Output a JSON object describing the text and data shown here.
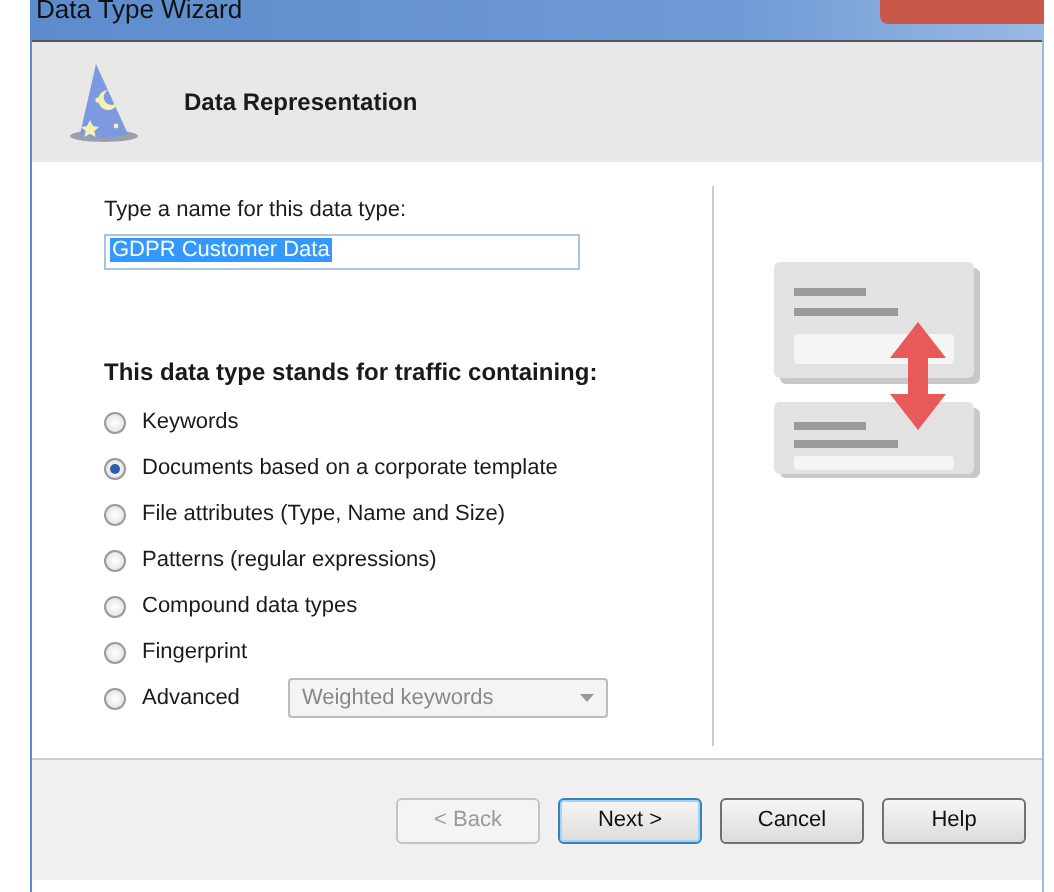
{
  "window": {
    "title": "Data Type Wizard"
  },
  "header": {
    "title": "Data Representation"
  },
  "name_field": {
    "label": "Type a name for this data type:",
    "value": "GDPR Customer Data"
  },
  "options_heading": "This data type stands for traffic containing:",
  "options": [
    {
      "label": "Keywords",
      "selected": false
    },
    {
      "label": "Documents based on a corporate template",
      "selected": true
    },
    {
      "label": "File attributes (Type, Name and Size)",
      "selected": false
    },
    {
      "label": "Patterns (regular expressions)",
      "selected": false
    },
    {
      "label": "Compound data types",
      "selected": false
    },
    {
      "label": "Fingerprint",
      "selected": false
    },
    {
      "label": "Advanced",
      "selected": false,
      "dropdown": {
        "value": "Weighted keywords",
        "disabled": true
      }
    }
  ],
  "buttons": [
    {
      "label": "< Back",
      "disabled": true,
      "focused": false
    },
    {
      "label": "Next >",
      "disabled": false,
      "focused": true
    },
    {
      "label": "Cancel",
      "disabled": false,
      "focused": false
    },
    {
      "label": "Help",
      "disabled": false,
      "focused": false
    }
  ]
}
